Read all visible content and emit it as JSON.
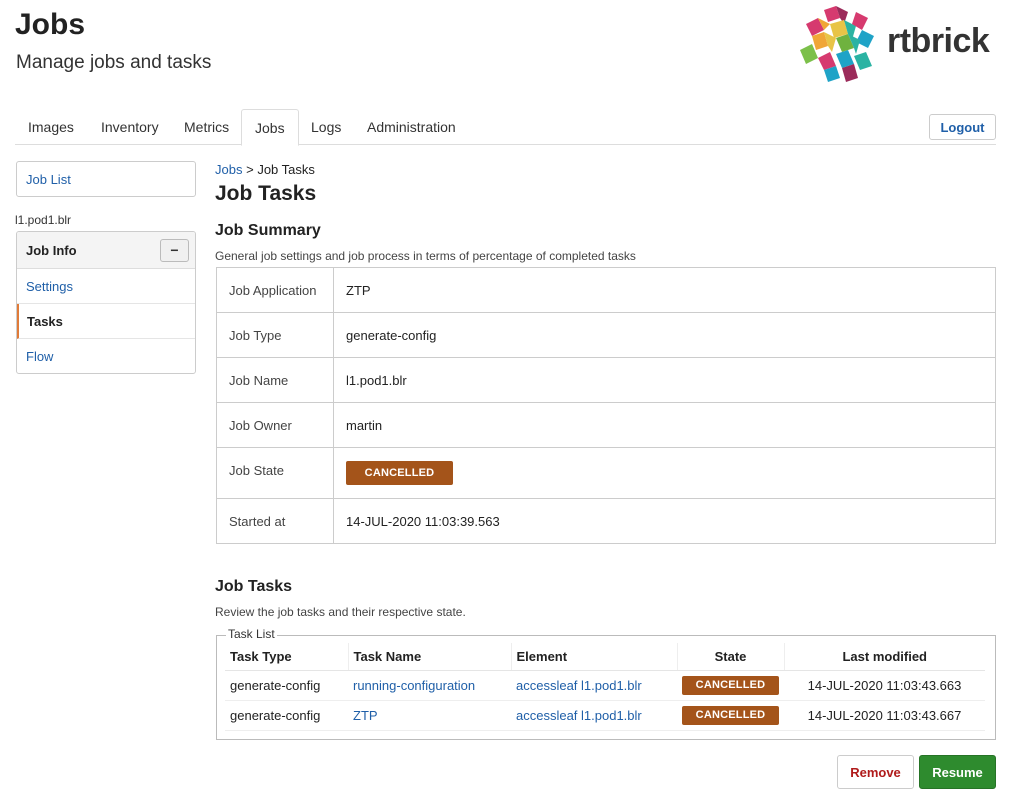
{
  "header": {
    "title": "Jobs",
    "subtitle": "Manage jobs and tasks",
    "brand": "rtbrick"
  },
  "tabs": [
    {
      "label": "Images",
      "active": false
    },
    {
      "label": "Inventory",
      "active": false
    },
    {
      "label": "Metrics",
      "active": false
    },
    {
      "label": "Jobs",
      "active": true
    },
    {
      "label": "Logs",
      "active": false
    },
    {
      "label": "Administration",
      "active": false
    }
  ],
  "logout_label": "Logout",
  "sidebar": {
    "job_list_label": "Job List",
    "job_label": "l1.pod1.blr",
    "panel_title": "Job Info",
    "collapse_symbol": "−",
    "items": [
      {
        "label": "Settings",
        "active": false
      },
      {
        "label": "Tasks",
        "active": true
      },
      {
        "label": "Flow",
        "active": false
      }
    ]
  },
  "breadcrumb": {
    "parent": "Jobs",
    "separator": ">",
    "current": "Job Tasks"
  },
  "main_title": "Job Tasks",
  "summary": {
    "title": "Job Summary",
    "description": "General job settings and job process in terms of percentage of completed tasks",
    "rows": {
      "application": {
        "label": "Job Application",
        "value": "ZTP"
      },
      "type": {
        "label": "Job Type",
        "value": "generate-config"
      },
      "name": {
        "label": "Job Name",
        "value": "l1.pod1.blr"
      },
      "owner": {
        "label": "Job Owner",
        "value": "martin"
      },
      "state": {
        "label": "Job State",
        "value": "CANCELLED"
      },
      "started": {
        "label": "Started at",
        "value": "14-JUL-2020 11:03:39.563"
      }
    }
  },
  "tasks": {
    "title": "Job Tasks",
    "description": "Review the job tasks and their respective state.",
    "legend": "Task List",
    "columns": [
      "Task Type",
      "Task Name",
      "Element",
      "State",
      "Last modified"
    ],
    "rows": [
      {
        "type": "generate-config",
        "name": "running-configuration",
        "element": "accessleaf l1.pod1.blr",
        "state": "CANCELLED",
        "modified": "14-JUL-2020 11:03:43.663"
      },
      {
        "type": "generate-config",
        "name": "ZTP",
        "element": "accessleaf l1.pod1.blr",
        "state": "CANCELLED",
        "modified": "14-JUL-2020 11:03:43.667"
      }
    ]
  },
  "actions": {
    "remove_label": "Remove",
    "resume_label": "Resume"
  },
  "colors": {
    "link": "#1f5fa8",
    "cancelled_badge": "#a4541a",
    "resume_button": "#2e8b2e",
    "remove_text": "#b01b1b",
    "active_indicator": "#e07b39"
  }
}
